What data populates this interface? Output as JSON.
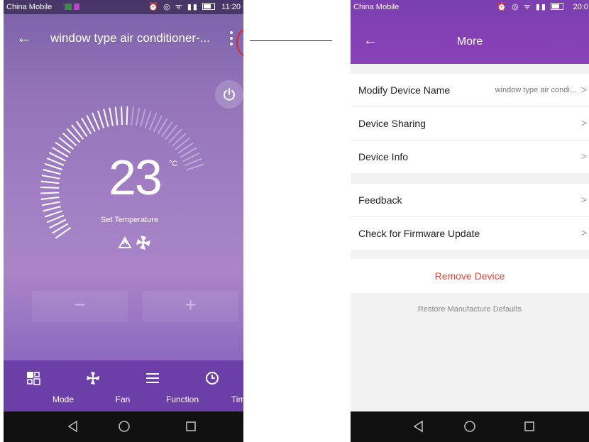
{
  "left_phone": {
    "status_bar": {
      "carrier": "China Mobile",
      "time": "11:20"
    },
    "header": {
      "title": "window type air conditioner-..."
    },
    "thermostat": {
      "temperature": "23",
      "unit": "°C",
      "label": "Set Temperature"
    },
    "controls": {
      "minus": "−",
      "plus": "+"
    },
    "bottom_nav": {
      "items": [
        {
          "label": "Mode",
          "icon": "mode-icon"
        },
        {
          "label": "Fan",
          "icon": "fan-icon"
        },
        {
          "label": "Function",
          "icon": "menu-icon"
        },
        {
          "label": "Timer",
          "icon": "clock-icon"
        }
      ]
    }
  },
  "right_phone": {
    "status_bar": {
      "carrier": "China Mobile",
      "time": "20:0"
    },
    "header": {
      "title": "More"
    },
    "groups": [
      {
        "rows": [
          {
            "label": "Modify Device Name",
            "value": "window type air condi..."
          },
          {
            "label": "Device Sharing",
            "value": ""
          },
          {
            "label": "Device Info",
            "value": ""
          }
        ]
      },
      {
        "rows": [
          {
            "label": "Feedback",
            "value": ""
          },
          {
            "label": "Check for Firmware Update",
            "value": ""
          }
        ]
      }
    ],
    "remove_device": "Remove Device",
    "restore_defaults": "Restore Manufacture Defaults"
  },
  "colors": {
    "accent_purple": "#7a3fb0",
    "highlight_red": "#d8262b",
    "remove_red": "#e8453c"
  }
}
